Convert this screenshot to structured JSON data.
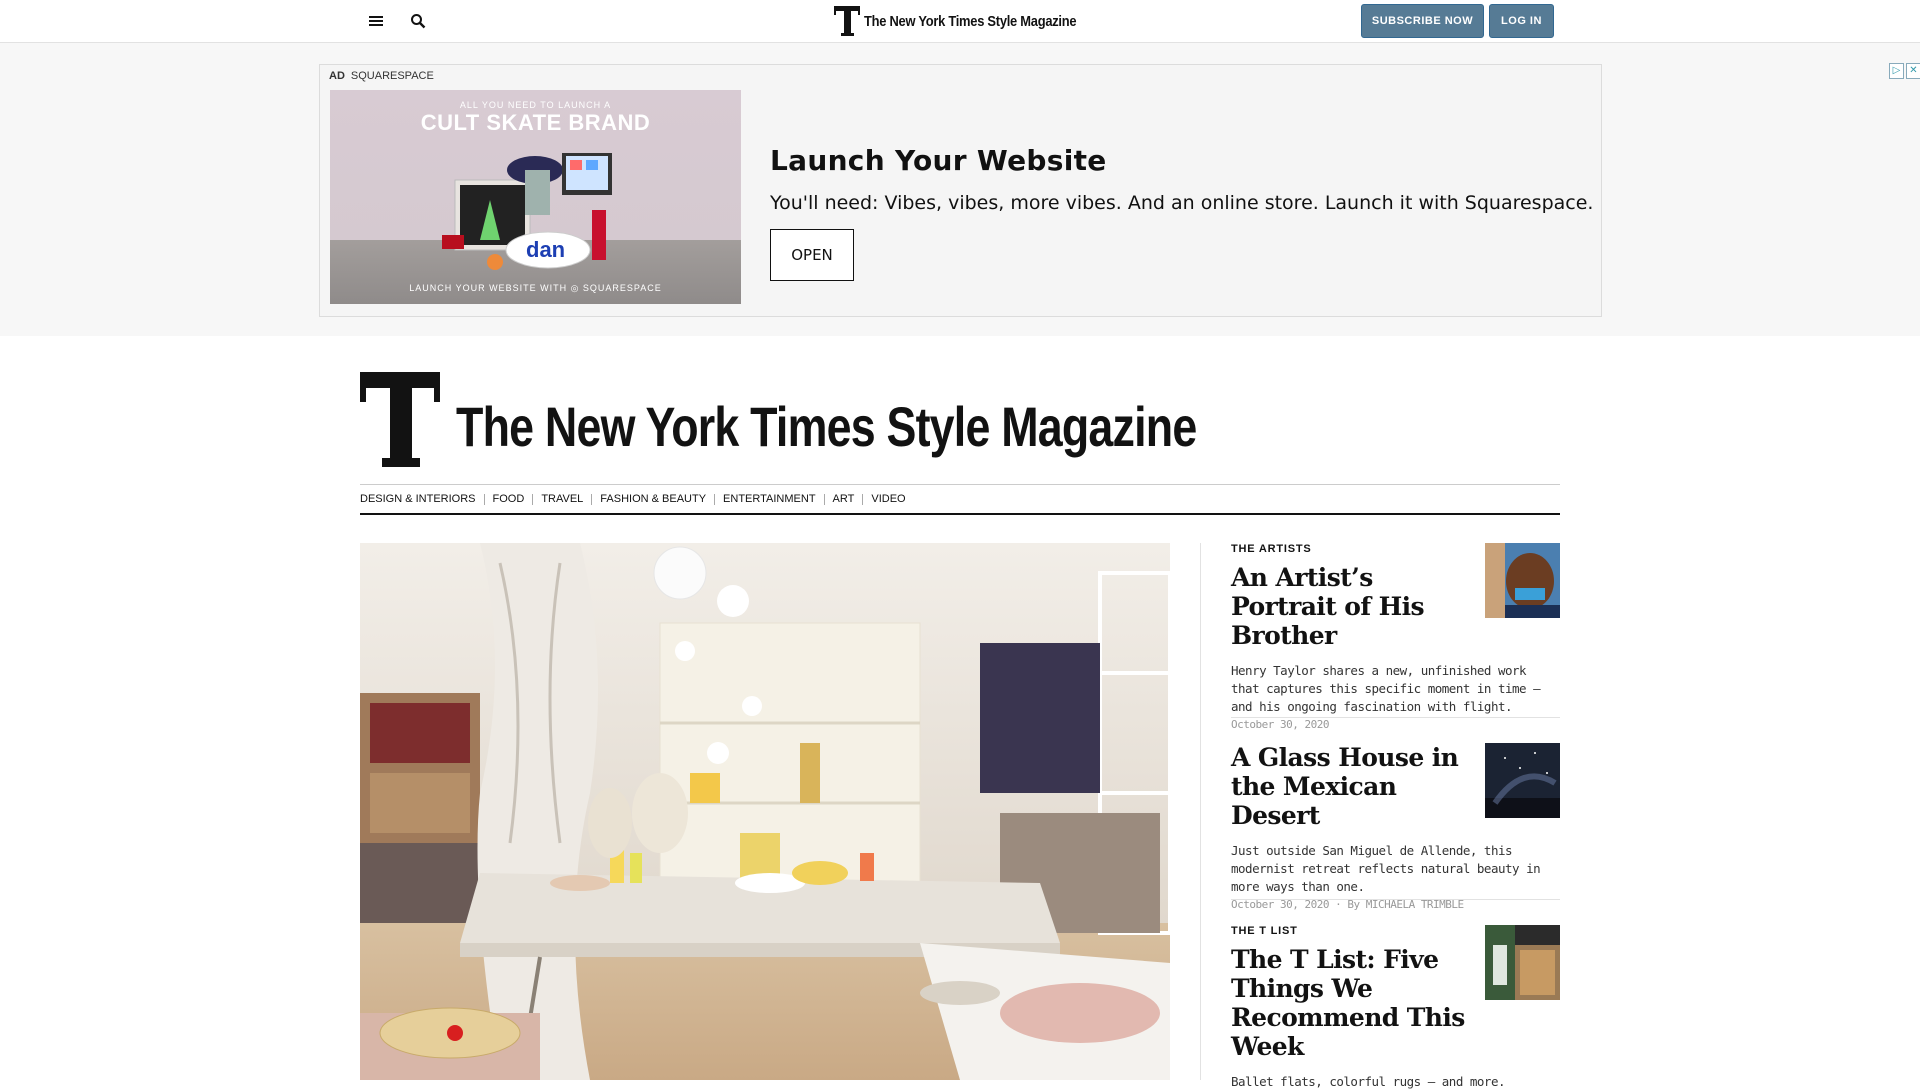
{
  "topbar": {
    "brand": "The New York Times Style Magazine",
    "subscribe_label": "SUBSCRIBE NOW",
    "login_label": "LOG IN"
  },
  "ad": {
    "label": "AD",
    "sponsor": "SQUARESPACE",
    "image_tag_top": "ALL YOU NEED TO LAUNCH A",
    "image_tag_main": "CULT SKATE BRAND",
    "image_tag_bottom": "LAUNCH YOUR WEBSITE WITH  ◎ SQUARESPACE",
    "title": "Launch Your Website",
    "copy": "You'll need: Vibes, vibes, more vibes. And an online store. Launch it with Squarespace.",
    "cta": "OPEN"
  },
  "masthead": {
    "title": "The New York Times Style Magazine"
  },
  "nav": {
    "items": [
      "DESIGN & INTERIORS",
      "FOOD",
      "TRAVEL",
      "FASHION & BEAUTY",
      "ENTERTAINMENT",
      "ART",
      "VIDEO"
    ]
  },
  "stories": [
    {
      "kicker": "THE ARTISTS",
      "headline": "An Artist’s Portrait of His Brother",
      "summary": "Henry Taylor shares a new, unfinished work that captures this specific moment in time — and his ongoing fascination with flight.",
      "date": "October 30, 2020",
      "byline": ""
    },
    {
      "kicker": "",
      "headline": "A Glass House in the Mexican Desert",
      "summary": "Just outside San Miguel de Allende, this modernist retreat reflects natural beauty in more ways than one.",
      "date": "October 30, 2020",
      "byline": "By MICHAELA TRIMBLE"
    },
    {
      "kicker": "THE T LIST",
      "headline": "The T List: Five Things We Recommend This Week",
      "summary": "Ballet flats, colorful rugs — and more.",
      "date": "",
      "byline": ""
    }
  ]
}
